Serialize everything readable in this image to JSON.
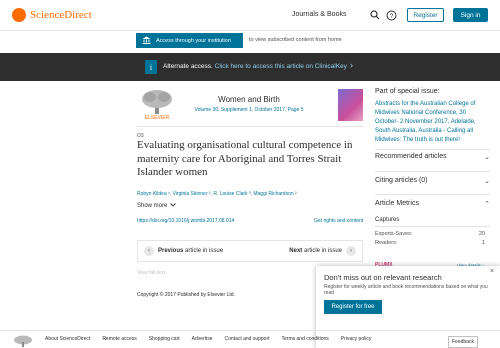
{
  "header": {
    "brand": "ScienceDirect",
    "journals_books": "Journals & Books",
    "register": "Register",
    "sign_in": "Sign in"
  },
  "access": {
    "button": "Access through your institution",
    "note": "to view subscribed content from home"
  },
  "alternate": {
    "lead": "Alternate access.",
    "link": "Click here to access this article on ClinicalKey"
  },
  "article": {
    "journal": "Women and Birth",
    "volume": "Volume 30, Supplement 1, October 2017, Page 5",
    "kicker": "O3",
    "title": "Evaluating organisational cultural competence in maternity care for Aboriginal and Torres Strait Islander women",
    "authors": "Robyn Kildea ¹, Virginia Skinner ², R. Louise Clark ³, Maggi Richardson ²",
    "show_more": "Show more",
    "doi": "https://doi.org/10.1016/j.wombi.2017.08.014",
    "rights": "Get rights and content",
    "prev_label": "Previous",
    "prev_rest": "article in issue",
    "next_label": "Next",
    "next_rest": "article in issue",
    "view_full": "View full text",
    "copyright": "Copyright © 2017 Published by Elsevier Ltd."
  },
  "sidebar": {
    "part_title": "Part of special issue:",
    "part_link": "Abstracts for the Australian College of Midwives National Conference, 30 October- 2 November 2017, Adelaide, South Australia, Australia - Calling all Midwives: The truth is out there!",
    "recommended": "Recommended articles",
    "citing": "Citing articles (0)",
    "metrics": "Article Metrics",
    "captures": "Captures",
    "exports_label": "Exports-Saves:",
    "exports_value": "20",
    "readers_label": "Readers:",
    "readers_value": "1",
    "plumx": "PLUMX",
    "view_details": "View details ›"
  },
  "popup": {
    "title": "Don't miss out on relevant research",
    "text": "Register for weekly article and book recommendations based on what you read",
    "button": "Register for free"
  },
  "footer": {
    "links": [
      "About ScienceDirect",
      "Remote access",
      "Shopping cart",
      "Advertise",
      "Contact and support",
      "Terms and conditions",
      "Privacy policy"
    ],
    "feedback": "Feedback"
  }
}
